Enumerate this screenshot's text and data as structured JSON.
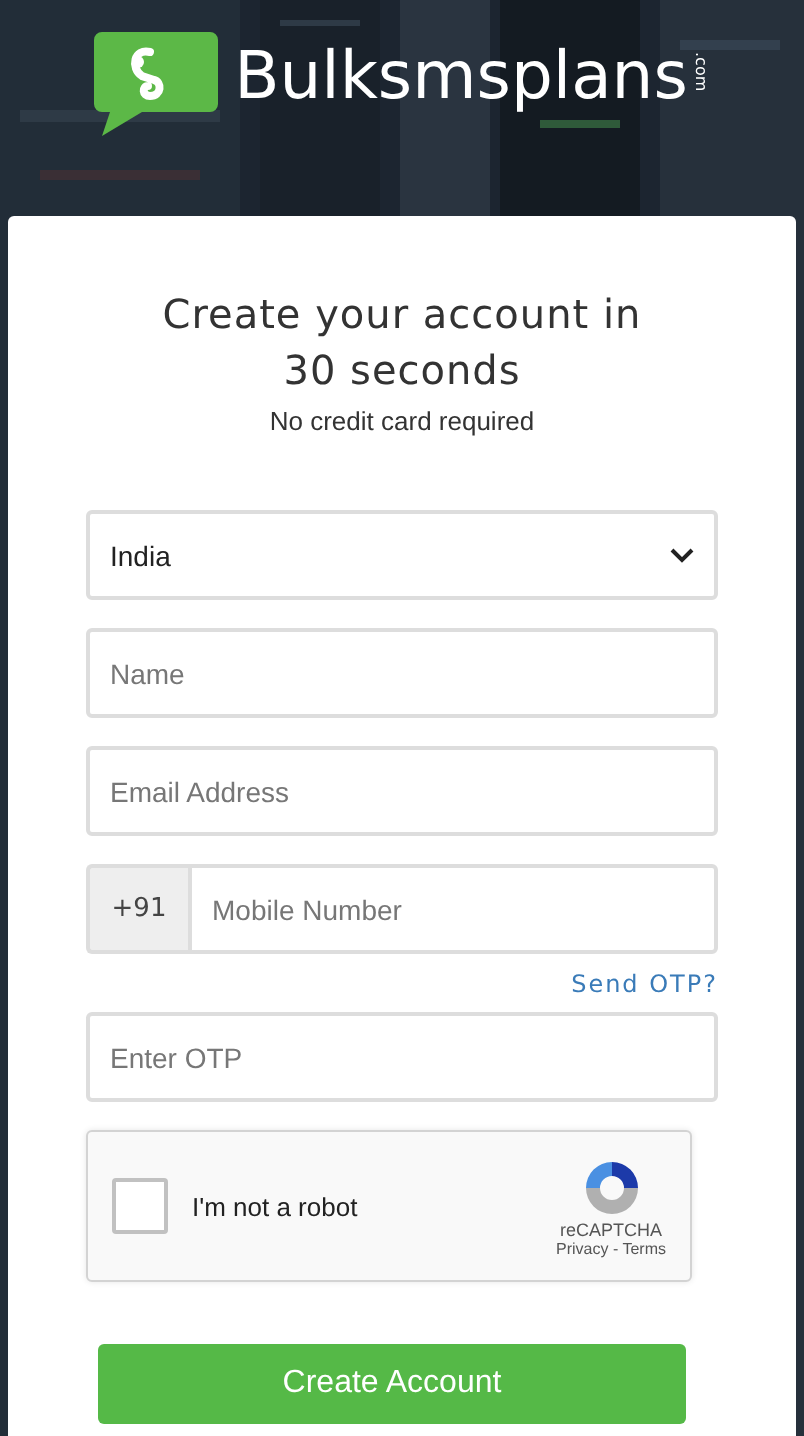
{
  "logo": {
    "name": "Bulksmsplans",
    "suffix": ".com"
  },
  "heading": {
    "title": "Create your account in 30 seconds",
    "subtitle": "No credit card required"
  },
  "country_select": {
    "value": "India"
  },
  "name_field": {
    "placeholder": "Name"
  },
  "email_field": {
    "placeholder": "Email Address"
  },
  "mobile_field": {
    "prefix": "+91",
    "placeholder": "Mobile Number"
  },
  "send_otp_link": "Send OTP?",
  "otp_field": {
    "placeholder": "Enter OTP"
  },
  "captcha": {
    "checked": false,
    "label": "I'm not a robot",
    "brand": "reCAPTCHA",
    "links": "Privacy - Terms"
  },
  "submit_button": "Create Account"
}
